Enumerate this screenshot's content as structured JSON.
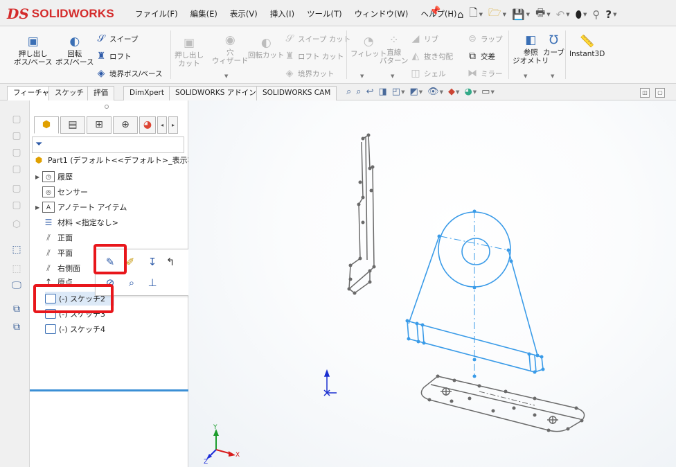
{
  "app": {
    "logo_mark": "DS",
    "logo_text": "SOLIDWORKS"
  },
  "menu": [
    "ファイル(F)",
    "編集(E)",
    "表示(V)",
    "挿入(I)",
    "ツール(T)",
    "ウィンドウ(W)",
    "ヘルプ(H)"
  ],
  "quick_access": [
    "home-icon",
    "new-document-icon",
    "open-icon",
    "save-icon",
    "print-icon",
    "undo-icon",
    "rebuild-icon",
    "user-icon",
    "help-icon"
  ],
  "ribbon": {
    "extrude_boss_line1": "押し出し",
    "extrude_boss_line2": "ボス/ベース",
    "revolve_boss_line1": "回転",
    "revolve_boss_line2": "ボス/ベース",
    "sweep_boss": "スイープ",
    "loft_boss": "ロフト",
    "boundary_boss": "境界ボス/ベース",
    "extrude_cut_line1": "押し出し",
    "extrude_cut_line2": "カット",
    "hole_wizard_line1": "穴",
    "hole_wizard_line2": "ウィザード",
    "revolve_cut": "回転カット",
    "sweep_cut": "スイープ カット",
    "loft_cut": "ロフト カット",
    "boundary_cut": "境界カット",
    "fillet": "フィレット",
    "linear_pattern_line1": "直線",
    "linear_pattern_line2": "パターン",
    "rib": "リブ",
    "draft": "抜き勾配",
    "shell": "シェル",
    "wrap": "ラップ",
    "intersect": "交差",
    "mirror": "ミラー",
    "ref_geometry_line1": "参照",
    "ref_geometry_line2": "ジオメトリ",
    "curves": "カーブ",
    "instant3d": "Instant3D"
  },
  "command_tabs": [
    "フィーチャー",
    "スケッチ",
    "評価",
    "DimXpert",
    "SOLIDWORKS アドイン",
    "SOLIDWORKS CAM"
  ],
  "feature_tree": {
    "part": "Part1 (デフォルト<<デフォルト>_表示状態 1>",
    "history": "履歴",
    "sensors": "センサー",
    "annotations": "アノテート アイテム",
    "material": "材料 <指定なし>",
    "front_plane": "正面",
    "top_plane": "平面",
    "right_plane": "右側面",
    "origin": "原点",
    "sketch2": "(-) スケッチ2",
    "sketch3": "(-) スケッチ3",
    "sketch4": "(-) スケッチ4"
  },
  "triad": {
    "x": "X",
    "y": "Y",
    "z": "Z"
  },
  "colors": {
    "sketch_blue": "#3a9be8",
    "highlight_red": "#e8161b",
    "sketch_gray": "#666666",
    "brand_red": "#d42b2b"
  }
}
